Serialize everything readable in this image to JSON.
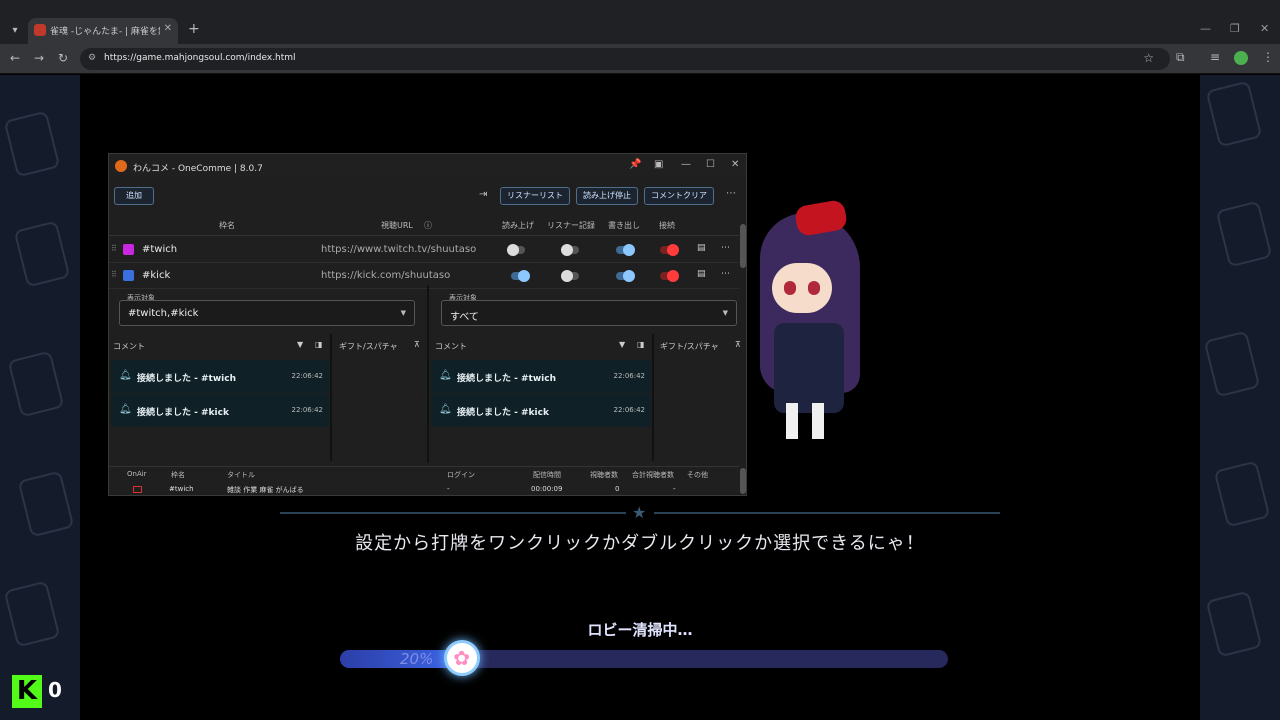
{
  "browser": {
    "tab_title": "雀魂 -じゃんたま- | 麻雀を無料で楽しもう",
    "url": "https://game.mahjongsoul.com/index.html",
    "new_tab_glyph": "+",
    "icons": [
      "tab-dropdown-icon",
      "back-icon",
      "forward-icon",
      "reload-icon",
      "site-info-icon",
      "star-icon",
      "extensions-icon",
      "media-icon",
      "profile-icon",
      "menu-icon"
    ]
  },
  "onecomme": {
    "title": "わんコメ - OneComme | 8.0.7",
    "add_label": "追加",
    "listener_list_label": "リスナーリスト",
    "stop_reading_label": "読み上げ停止",
    "clear_comments_label": "コメントクリア",
    "columns": {
      "name": "枠名",
      "url": "視聴URL",
      "read": "読み上げ",
      "listener_log": "リスナー記録",
      "export": "書き出し",
      "connect": "接続"
    },
    "connections": [
      {
        "name": "#twich",
        "url": "https://www.twitch.tv/shuutaso",
        "color": "#c928e0"
      },
      {
        "name": "#kick",
        "url": "https://kick.com/shuutaso",
        "color": "#3a6fe0"
      }
    ],
    "left_pane": {
      "target_label": "表示対象",
      "target_value": "#twitch,#kick",
      "comment_col": "コメント",
      "gift_col": "ギフト/スパチャ",
      "comments": [
        {
          "text": "接続しました - #twich",
          "time": "22:06:42"
        },
        {
          "text": "接続しました - #kick",
          "time": "22:06:42"
        }
      ]
    },
    "right_pane": {
      "target_label": "表示対象",
      "target_value": "すべて",
      "comment_col": "コメント",
      "gift_col": "ギフト/スパチャ",
      "comments": [
        {
          "text": "接続しました - #twich",
          "time": "22:06:42"
        },
        {
          "text": "接続しました - #kick",
          "time": "22:06:42"
        }
      ]
    },
    "stats": {
      "headers": {
        "onair": "OnAir",
        "name": "枠名",
        "title": "タイトル",
        "login": "ログイン",
        "duration": "配信時間",
        "viewers": "視聴者数",
        "total_viewers": "合計視聴者数",
        "other": "その他"
      },
      "row": {
        "name": "#twich",
        "title": "雑談 作業 麻雀 がんばる",
        "login": "-",
        "duration": "00:00:09",
        "viewers": "0",
        "total_viewers": "-"
      }
    }
  },
  "game": {
    "tip": "設定から打牌をワンクリックかダブルクリックか選択できるにゃ！",
    "status": "ロビー清掃中…",
    "progress_text": "20%",
    "progress": 0.2,
    "viewer_count": "0",
    "logo_letter": "K"
  }
}
